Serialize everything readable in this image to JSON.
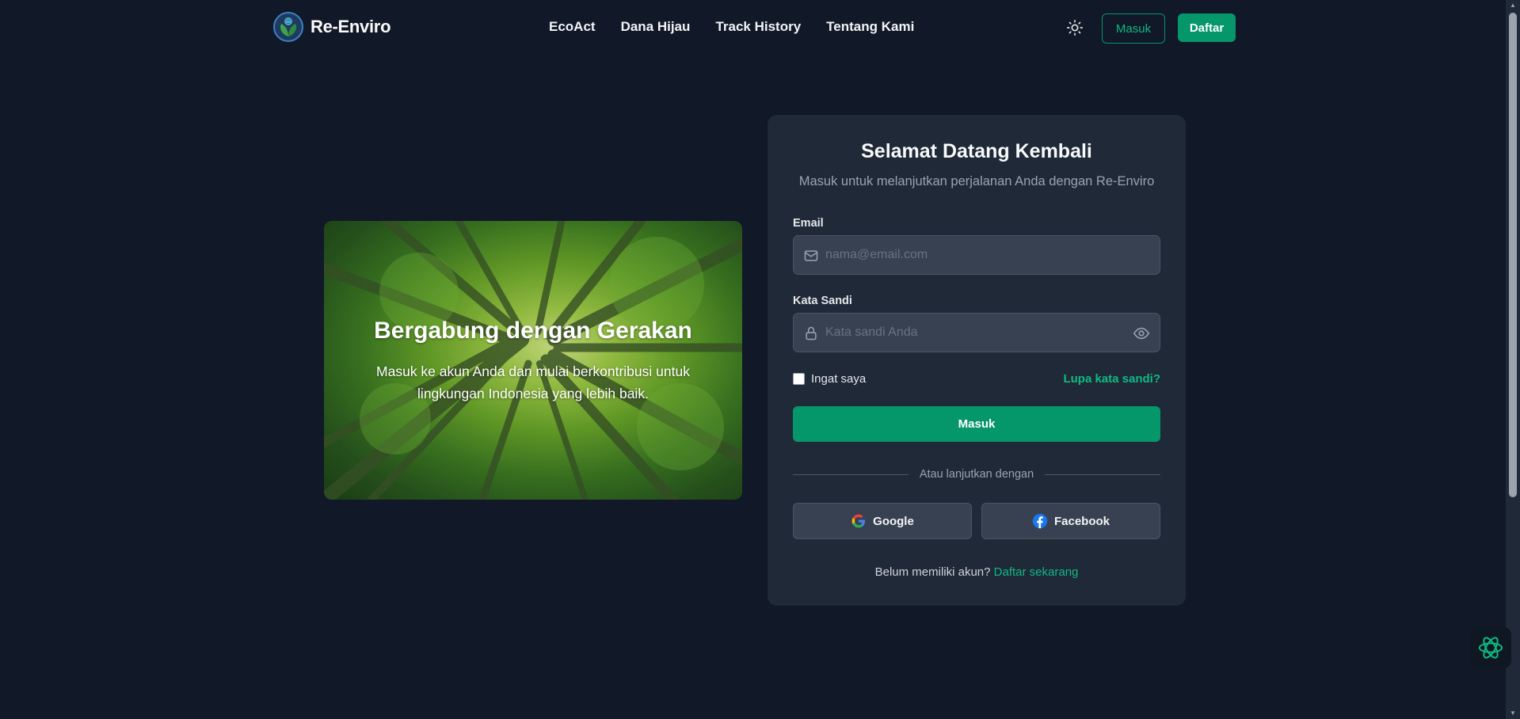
{
  "brand": {
    "name": "Re-Enviro",
    "logo_icon": "leaf-globe-icon"
  },
  "nav": {
    "links": [
      {
        "label": "EcoAct"
      },
      {
        "label": "Dana Hijau"
      },
      {
        "label": "Track History"
      },
      {
        "label": "Tentang Kami"
      }
    ],
    "theme_icon": "sun-icon",
    "login_label": "Masuk",
    "register_label": "Daftar"
  },
  "hero": {
    "title": "Bergabung dengan Gerakan",
    "description": "Masuk ke akun Anda dan mulai berkontribusi untuk lingkungan Indonesia yang lebih baik."
  },
  "login": {
    "title": "Selamat Datang Kembali",
    "subtitle": "Masuk untuk melanjutkan perjalanan Anda dengan Re-Enviro",
    "email_label": "Email",
    "email_placeholder": "nama@email.com",
    "email_value": "",
    "password_label": "Kata Sandi",
    "password_placeholder": "Kata sandi Anda",
    "password_value": "",
    "remember_label": "Ingat saya",
    "remember_checked": false,
    "forgot_label": "Lupa kata sandi?",
    "submit_label": "Masuk",
    "divider_text": "Atau lanjutkan dengan",
    "google_label": "Google",
    "facebook_label": "Facebook",
    "signup_prompt": "Belum memiliki akun?",
    "signup_link": "Daftar sekarang"
  },
  "colors": {
    "background": "#111827",
    "card": "#1f2937",
    "accent": "#059669",
    "accent_text": "#10b981"
  }
}
